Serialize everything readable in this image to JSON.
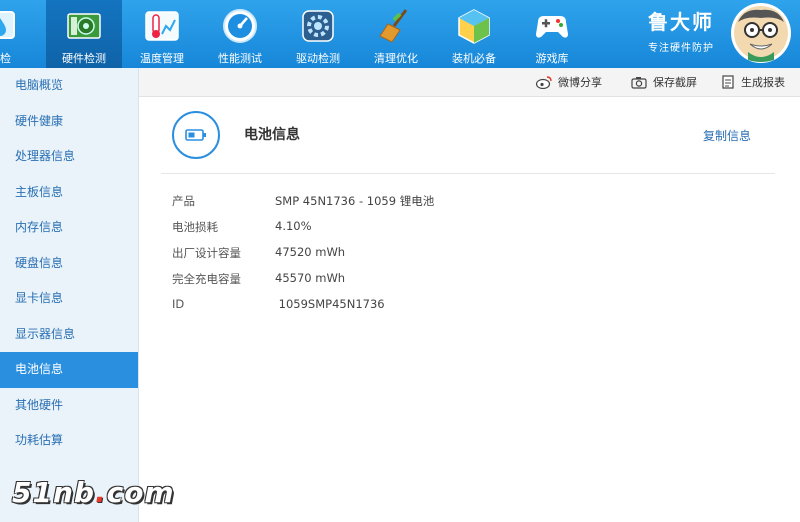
{
  "nav": [
    {
      "label": "体检",
      "icon": "checkup-icon"
    },
    {
      "label": "硬件检测",
      "icon": "hardware-icon"
    },
    {
      "label": "温度管理",
      "icon": "thermometer-icon"
    },
    {
      "label": "性能测试",
      "icon": "speedometer-icon"
    },
    {
      "label": "驱动检测",
      "icon": "driver-gear-icon"
    },
    {
      "label": "清理优化",
      "icon": "broom-icon"
    },
    {
      "label": "装机必备",
      "icon": "package-cube-icon"
    },
    {
      "label": "游戏库",
      "icon": "gamepad-icon"
    }
  ],
  "brand": {
    "name": "鲁大师",
    "slogan": "专注硬件防护"
  },
  "sidebar": {
    "items": [
      "电脑概览",
      "硬件健康",
      "处理器信息",
      "主板信息",
      "内存信息",
      "硬盘信息",
      "显卡信息",
      "显示器信息",
      "电池信息",
      "其他硬件",
      "功耗估算"
    ],
    "active_index": 8
  },
  "toolbar": {
    "share": "微博分享",
    "screenshot": "保存截屏",
    "report": "生成报表"
  },
  "section": {
    "title": "电池信息",
    "copy": "复制信息"
  },
  "battery": [
    {
      "key": "产品",
      "value": "SMP 45N1736 -  1059 锂电池"
    },
    {
      "key": "电池损耗",
      "value": "4.10%"
    },
    {
      "key": "出厂设计容量",
      "value": "47520 mWh"
    },
    {
      "key": "完全充电容量",
      "value": "45570 mWh"
    },
    {
      "key": "ID",
      "value": " 1059SMP45N1736"
    }
  ],
  "watermark": {
    "prefix": "51nb",
    "dot": ".",
    "suffix": "com"
  },
  "colors": {
    "topbar": "#1f93e3",
    "accent": "#2b8fe0",
    "sidebar_bg": "#e9f3f9",
    "link": "#2a6fb4"
  }
}
